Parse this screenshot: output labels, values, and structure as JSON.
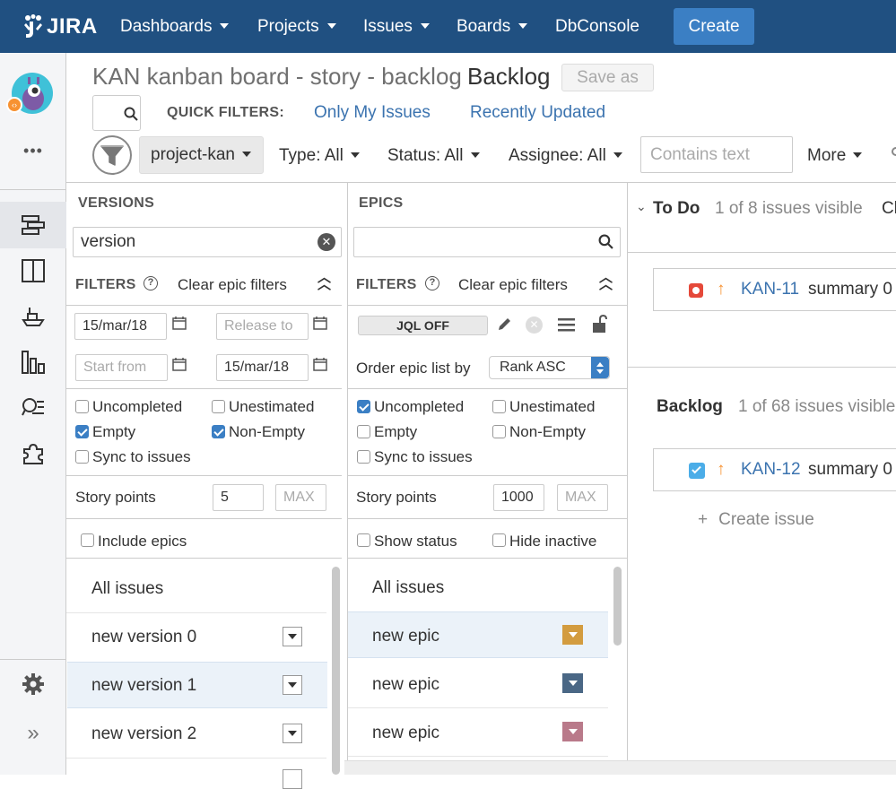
{
  "nav": {
    "logo": "JIRA",
    "items": [
      {
        "label": "Dashboards",
        "caret": true
      },
      {
        "label": "Projects",
        "caret": true
      },
      {
        "label": "Issues",
        "caret": true
      },
      {
        "label": "Boards",
        "caret": true
      },
      {
        "label": "DbConsole",
        "caret": false
      }
    ],
    "create_label": "Create"
  },
  "sidebar": {
    "more_label": "•••",
    "expand_label": "»",
    "icons": [
      "backlog-icon",
      "board-icon",
      "releases-icon",
      "reports-icon",
      "issue-search-icon",
      "addons-icon"
    ],
    "settings_icon": "gear-icon"
  },
  "header": {
    "title": "KAN kanban board - story - backlog",
    "view": "Backlog",
    "save_as": "Save as"
  },
  "quick_filters": {
    "label": "QUICK FILTERS:",
    "links": [
      "Only My Issues",
      "Recently Updated"
    ]
  },
  "filter_bar": {
    "project": "project-kan",
    "dropdowns": [
      "Type: All",
      "Status: All",
      "Assignee: All"
    ],
    "contains_placeholder": "Contains text",
    "more": "More"
  },
  "versions": {
    "heading": "VERSIONS",
    "search_value": "version",
    "filters_label": "FILTERS",
    "clear_label": "Clear epic filters",
    "release_from": "15/mar/18",
    "release_to_placeholder": "Release to",
    "start_from_placeholder": "Start from",
    "start_to": "15/mar/18",
    "checks": {
      "uncompleted": {
        "label": "Uncompleted",
        "checked": false
      },
      "unestimated": {
        "label": "Unestimated",
        "checked": false
      },
      "empty": {
        "label": "Empty",
        "checked": true
      },
      "non_empty": {
        "label": "Non-Empty",
        "checked": true
      },
      "sync": {
        "label": "Sync to issues",
        "checked": false
      }
    },
    "story_points_label": "Story points",
    "story_points_min": "5",
    "story_points_max_placeholder": "MAX",
    "include_epics": "Include epics",
    "all_issues": "All issues",
    "items": [
      "new version 0",
      "new version 1",
      "new version 2"
    ]
  },
  "epics": {
    "heading": "EPICS",
    "filters_label": "FILTERS",
    "clear_label": "Clear epic filters",
    "jql": "JQL OFF",
    "order_label": "Order epic list by",
    "order_value": "Rank ASC",
    "checks": {
      "uncompleted": {
        "label": "Uncompleted",
        "checked": true
      },
      "unestimated": {
        "label": "Unestimated",
        "checked": false
      },
      "empty": {
        "label": "Empty",
        "checked": false
      },
      "non_empty": {
        "label": "Non-Empty",
        "checked": false
      },
      "sync": {
        "label": "Sync to issues",
        "checked": false
      }
    },
    "story_points_label": "Story points",
    "story_points_min": "1000",
    "story_points_max_placeholder": "MAX",
    "show_status": "Show status",
    "hide_inactive": "Hide inactive",
    "all_issues": "All issues",
    "items": [
      {
        "label": "new epic",
        "color": "#d39c3f"
      },
      {
        "label": "new epic",
        "color": "#4a6785"
      },
      {
        "label": "new epic",
        "color": "#b97a8a"
      }
    ]
  },
  "board": {
    "todo": {
      "title": "To Do",
      "count": "1 of 8 issues visible",
      "clear": "Cl"
    },
    "todo_issue": {
      "key": "KAN-11",
      "summary": "summary 0",
      "type_color": "#e5493a"
    },
    "backlog": {
      "title": "Backlog",
      "count": "1 of 68 issues visible"
    },
    "backlog_issue": {
      "key": "KAN-12",
      "summary": "summary 0",
      "type_color": "#4bade8"
    },
    "create_issue": "Create issue"
  },
  "colors": {
    "nav_bg": "#205081",
    "create_btn": "#3b7fc4",
    "link": "#3b73af",
    "priority_high": "#f79232"
  }
}
